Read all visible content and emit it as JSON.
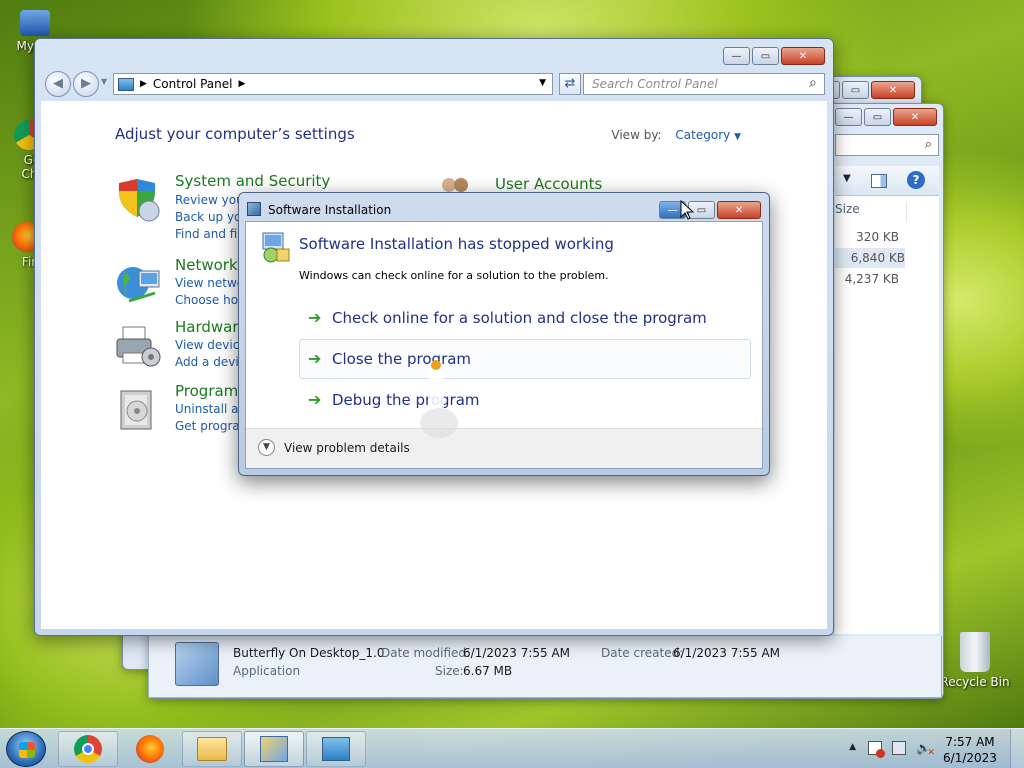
{
  "desktop": {
    "icons": [
      {
        "label": "My Co"
      },
      {
        "label": "Go Chr"
      },
      {
        "label": "Fir"
      },
      {
        "label": "Recycle Bin"
      }
    ]
  },
  "back_window": {
    "size_header": "Size",
    "sizes": [
      "320 KB",
      "6,840 KB",
      "4,237 KB"
    ]
  },
  "control_panel": {
    "breadcrumb": "Control Panel",
    "search_placeholder": "Search Control Panel",
    "title": "Adjust your computer’s settings",
    "view_by_label": "View by:",
    "view_by_value": "Category",
    "categories": [
      {
        "head": "System and Security",
        "links": [
          "Review your",
          "Back up you",
          "Find and fix"
        ]
      },
      {
        "head": "Network",
        "links": [
          "View networ",
          "Choose hon"
        ]
      },
      {
        "head": "Hardware",
        "links": [
          "View device",
          "Add a devic"
        ]
      },
      {
        "head": "Programs",
        "links": [
          "Uninstall a p",
          "Get program"
        ]
      },
      {
        "head": "User Accounts",
        "links": []
      }
    ]
  },
  "details_pane": {
    "name": "Butterfly On Desktop_1.0",
    "type": "Application",
    "modified_label": "Date modified:",
    "modified_value": "6/1/2023 7:55 AM",
    "size_label": "Size:",
    "size_value": "6.67 MB",
    "created_label": "Date created:",
    "created_value": "6/1/2023 7:55 AM"
  },
  "dialog": {
    "title": "Software Installation",
    "heading": "Software Installation has stopped working",
    "message": "Windows can check online for a solution to the problem.",
    "options": [
      "Check online for a solution and close the program",
      "Close the program",
      "Debug the program"
    ],
    "details_toggle": "View problem details"
  },
  "taskbar": {
    "time": "7:57 AM",
    "date": "6/1/2023"
  },
  "colors": {
    "link_blue": "#1e5aa8",
    "category_green": "#1b7a1e",
    "title_blue": "#1e3287",
    "close_red": "#c8432a"
  }
}
